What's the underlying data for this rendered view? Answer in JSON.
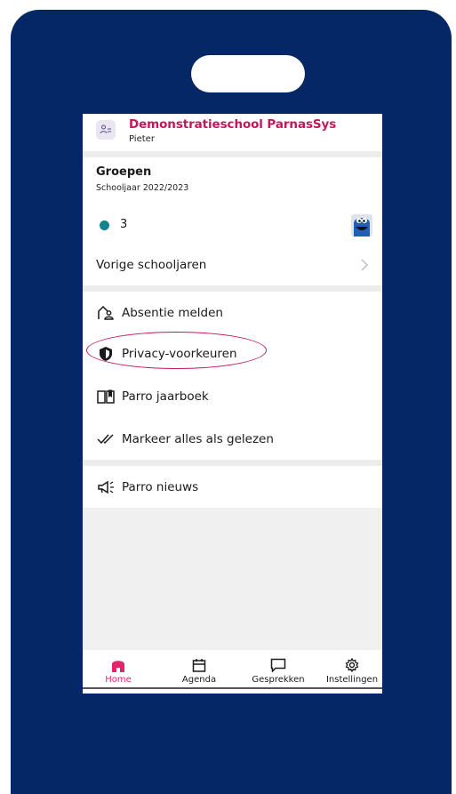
{
  "header": {
    "school_name": "Demonstratieschool ParnasSys",
    "user_name": "Pieter"
  },
  "groups": {
    "title": "Groepen",
    "school_year": "Schooljaar 2022/2023",
    "group_count": "3",
    "group_dot_color": "#13828c",
    "previous_years_label": "Vorige schooljaren"
  },
  "menu": {
    "absence_label": "Absentie melden",
    "privacy_label": "Privacy-voorkeuren",
    "yearbook_label": "Parro jaarboek",
    "mark_read_label": "Markeer alles als gelezen",
    "news_label": "Parro nieuws"
  },
  "tabs": [
    {
      "label": "Home",
      "icon": "home-icon",
      "active": true
    },
    {
      "label": "Agenda",
      "icon": "calendar-icon",
      "active": false
    },
    {
      "label": "Gesprekken",
      "icon": "chat-icon",
      "active": false
    },
    {
      "label": "Instellingen",
      "icon": "gear-icon",
      "active": false
    }
  ],
  "colors": {
    "frame": "#062766",
    "brand": "#c2185b",
    "active_tab": "#e2246b",
    "highlight": "#c2185b"
  }
}
